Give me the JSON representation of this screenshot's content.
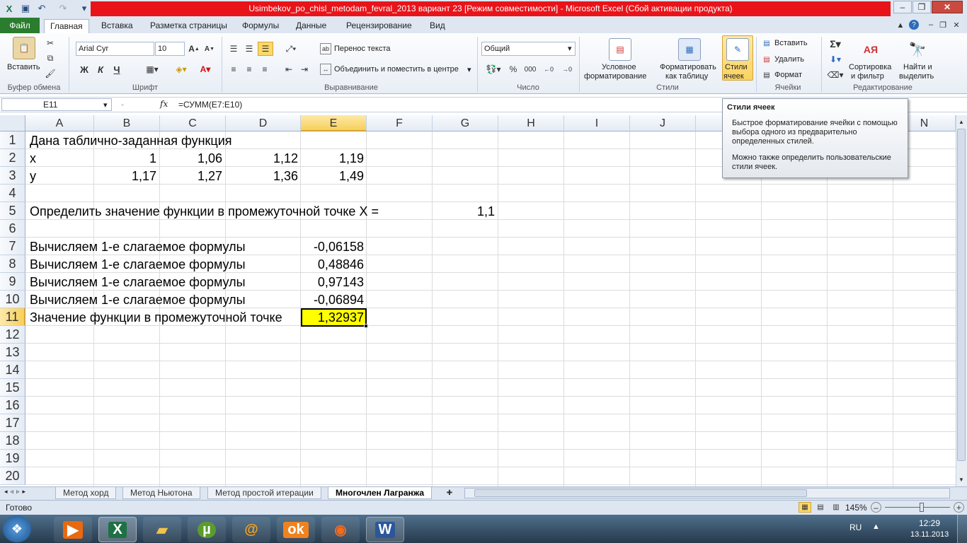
{
  "window": {
    "title": "Usimbekov_po_chisl_metodam_fevral_2013 вариант 23  [Режим совместимости]  -  Microsoft Excel (Сбой активации продукта)"
  },
  "tabs": {
    "file": "Файл",
    "items": [
      "Главная",
      "Вставка",
      "Разметка страницы",
      "Формулы",
      "Данные",
      "Рецензирование",
      "Вид"
    ]
  },
  "ribbon": {
    "clipboard": {
      "paste": "Вставить",
      "group": "Буфер обмена"
    },
    "font": {
      "name": "Arial Cyr",
      "size": "10",
      "group": "Шрифт",
      "bold": "Ж",
      "italic": "К",
      "underline": "Ч"
    },
    "alignment": {
      "wrap": "Перенос текста",
      "merge": "Объединить и поместить в центре",
      "group": "Выравнивание"
    },
    "number": {
      "format": "Общий",
      "group": "Число",
      "percent": "%",
      "thousands": "000"
    },
    "styles": {
      "conditional_1": "Условное",
      "conditional_2": "форматирование",
      "table_1": "Форматировать",
      "table_2": "как таблицу",
      "cell_1": "Стили",
      "cell_2": "ячеек",
      "group": "Стили"
    },
    "cells": {
      "insert": "Вставить",
      "delete": "Удалить",
      "format": "Формат",
      "group": "Ячейки"
    },
    "editing": {
      "sort_1": "Сортировка",
      "sort_2": "и фильтр",
      "find_1": "Найти и",
      "find_2": "выделить",
      "group": "Редактирование"
    }
  },
  "formula_bar": {
    "name_box": "E11",
    "fx": "fx",
    "formula": "=СУММ(E7:E10)"
  },
  "columns": [
    "A",
    "B",
    "C",
    "D",
    "E",
    "F",
    "G",
    "H",
    "I",
    "J",
    "K",
    "L",
    "M",
    "N"
  ],
  "rows": [
    "1",
    "2",
    "3",
    "4",
    "5",
    "6",
    "7",
    "8",
    "9",
    "10",
    "11",
    "12",
    "13",
    "14",
    "15",
    "16",
    "17",
    "18",
    "19",
    "20"
  ],
  "cells": {
    "r1": "Дана таблично-заданная функция",
    "r2": {
      "a": "x",
      "b": "1",
      "c": "1,06",
      "d": "1,12",
      "e": "1,19"
    },
    "r3": {
      "a": "y",
      "b": "1,17",
      "c": "1,27",
      "d": "1,36",
      "e": "1,49"
    },
    "r5": {
      "a": "Определить значение функции в промежуточной точке X =",
      "g": "1,1"
    },
    "r7": {
      "a": "Вычисляем 1-е слагаемое формулы",
      "e": "-0,06158"
    },
    "r8": {
      "a": "Вычисляем 1-е слагаемое формулы",
      "e": "0,48846"
    },
    "r9": {
      "a": "Вычисляем 1-е слагаемое формулы",
      "e": "0,97143"
    },
    "r10": {
      "a": "Вычисляем 1-е слагаемое формулы",
      "e": "-0,06894"
    },
    "r11": {
      "a": "Значение функции в промежуточной точке",
      "e": "1,32937"
    }
  },
  "sheets": [
    "Метод хорд",
    "Метод Ньютона",
    "Метод простой итерации",
    "Многочлен Лагранжа"
  ],
  "active_sheet": "Многочлен Лагранжа",
  "status": {
    "ready": "Готово",
    "zoom": "145%"
  },
  "tooltip": {
    "title": "Стили ячеек",
    "body1": "Быстрое форматирование ячейки с помощью выбора одного из предварительно определенных стилей.",
    "body2": "Можно также определить пользовательские стили ячеек."
  },
  "taskbar": {
    "lang": "RU",
    "time": "12:29",
    "date": "13.11.2013"
  },
  "colors": {
    "highlight": "#ffff00",
    "excel_green": "#2a7d2e",
    "title_red": "#e8141a"
  }
}
